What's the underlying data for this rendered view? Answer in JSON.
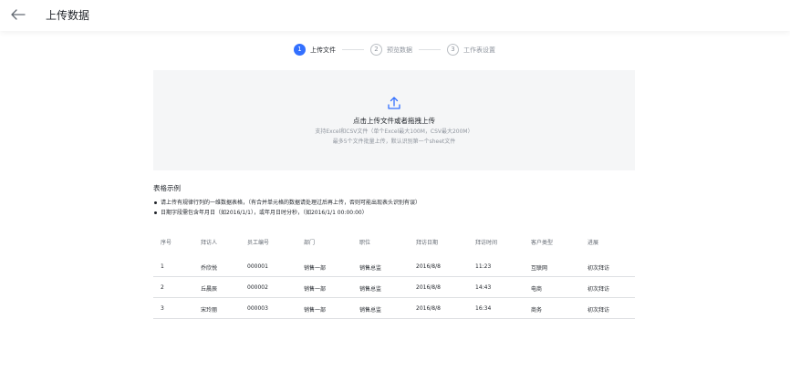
{
  "header": {
    "title": "上传数据"
  },
  "steps": [
    {
      "number": "1",
      "label": "上传文件"
    },
    {
      "number": "2",
      "label": "预览数据"
    },
    {
      "number": "3",
      "label": "工作表设置"
    }
  ],
  "upload": {
    "main_text": "点击上传文件或者拖拽上传",
    "sub_text_1": "支持Excel和CSV文件（单个Excel最大100M，CSV最大200M）",
    "sub_text_2": "最多5个文件批量上传，默认识别第一个sheet文件"
  },
  "example": {
    "title": "表格示例",
    "notes": [
      "请上传有规律行列的一维数据表格，（有合并单元格的数据请处理过后再上传，否则可能出现表头识别有误）",
      "日期字段需包含年月日（如2016/1/1），或年月日时分秒，（如2016/1/1 00:00:00）"
    ],
    "columns": [
      "序号",
      "拜访人",
      "员工编号",
      "部门",
      "职位",
      "拜访日期",
      "拜访时间",
      "客户类型",
      "进展"
    ],
    "rows": [
      [
        "1",
        "乔欣悦",
        "000001",
        "销售一部",
        "销售总监",
        "2016/8/8",
        "11:23",
        "互联网",
        "初次拜访"
      ],
      [
        "2",
        "丘晨辰",
        "000002",
        "销售一部",
        "销售总监",
        "2016/8/8",
        "14:43",
        "电商",
        "初次拜访"
      ],
      [
        "3",
        "宋玲丽",
        "000003",
        "销售一部",
        "销售总监",
        "2016/8/8",
        "16:34",
        "商务",
        "初次拜访"
      ]
    ]
  },
  "colors": {
    "accent": "#3370ff",
    "muted": "#8f959e",
    "border": "#dee0e3",
    "upload_bg": "#f5f6f7"
  }
}
